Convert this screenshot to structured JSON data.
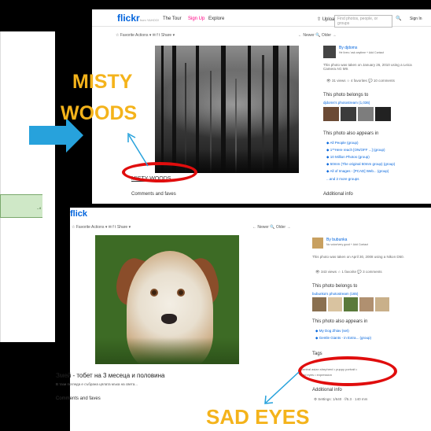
{
  "left": {
    "shape_text": "n"
  },
  "screenshot1": {
    "logo_main": "flickr",
    "logo_sub": "from YAHOO!",
    "nav": [
      "The Tour",
      "Sign Up",
      "Explore"
    ],
    "upload": "⇧ Upload",
    "search_placeholder": "Find photos, people, or groups",
    "sign_in": "Sign In",
    "toolbar": "☆ Favorite   Actions ▾   ✉ f t   Share ▾",
    "pager": "← Newer  🔍  Older →",
    "owner": "By djdoms",
    "owner_sub": "He lives / ask anytime  + Add Contact",
    "taken": "This photo was taken on January 26, 2010 using a Leica Camera AG M9.",
    "stats": "👁 31 views  ☆ 4 favorites  💬 10 comments",
    "belongs_heading": "This photo belongs to",
    "photostream": "djdoms's photostream (1,036)",
    "appears_heading": "This photo also appears in",
    "groups": [
      "◆ All People (group)",
      "◆ 1**Here reach [ON/OFF ...] (group)",
      "◆ 10 Million Photos (group)",
      "◆ 50mm (The original 50mm group) (group)",
      "◆ All of Images - [PCAD] Web... (group)",
      "...and 2 more groups"
    ],
    "additional": "Additional info",
    "caption": "MISTY WOODS",
    "comments": "Comments and faves"
  },
  "screenshot2": {
    "logo_main": "flick",
    "toolbar": "☆ Favorite   Actions ▾   ✉ f t   Share ▾",
    "pager": "← Newer  🔍  Older →",
    "owner": "By bubunka",
    "owner_sub": "No voice/very good   + Add Contact",
    "taken": "This photo was taken on April 30, 2008 using a Nikon D50.",
    "stats": "👁 343 views  ☆ 1 favorite  💬 3 comments",
    "belongs_heading": "This photo belongs to",
    "photostream": "bubunka's photostream (165)",
    "appears_heading": "This photo also appears in",
    "groups": [
      "◆ My Dog Zhiav (set)",
      "◆ Gentle Giants - in Extra... (group)"
    ],
    "tags_heading": "Tags",
    "tags_line1": "central asian shepherd  •  puppy portrait  •",
    "tags_line2": "sad eyes  •  expression",
    "additional": "Additional info",
    "settings": "⚙ Settings: 1/640 · f/5.3 · 140 mm",
    "caption": "Змей - тобет на 3 месеца и половина",
    "sub": "В тази погледа е събрана цялата мъка на света...",
    "comments": "Comments and faves"
  },
  "annotations": {
    "misty_line1": "MISTY",
    "misty_line2": "WOODS",
    "sad_eyes": "SAD EYES",
    "oval_color": "#e00d0d",
    "label_color": "#f4b31b",
    "arrow_color": "#27a2dc"
  }
}
